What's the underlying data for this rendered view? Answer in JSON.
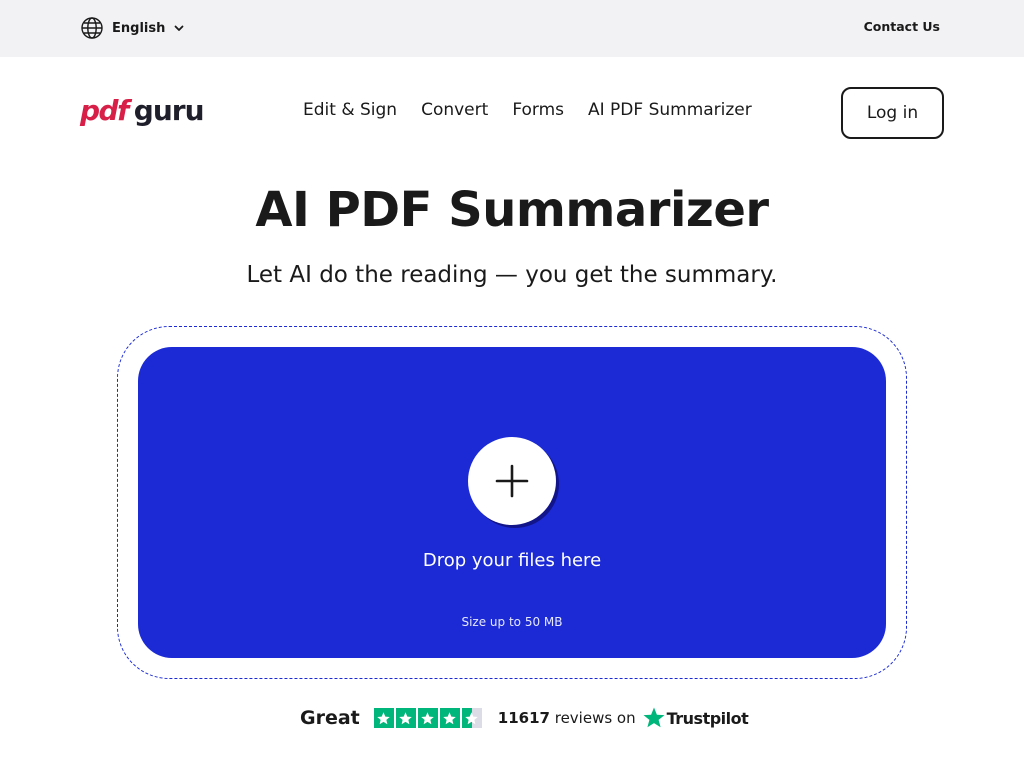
{
  "topbar": {
    "language_label": "English",
    "contact_label": "Contact Us"
  },
  "header": {
    "logo": {
      "part1": "pdf",
      "part2": "guru"
    },
    "nav": [
      {
        "label": "Edit & Sign"
      },
      {
        "label": "Convert"
      },
      {
        "label": "Forms"
      },
      {
        "label": "AI PDF Summarizer"
      }
    ],
    "login_label": "Log in"
  },
  "hero": {
    "title": "AI PDF Summarizer",
    "subtitle": "Let AI do the reading — you get the summary."
  },
  "dropzone": {
    "drop_label": "Drop your files here",
    "size_note": "Size up to 50 MB",
    "icon": "plus-icon"
  },
  "trustpilot": {
    "rating_word": "Great",
    "stars": 4.5,
    "review_count": "11617",
    "reviews_suffix": "reviews on",
    "brand": "Trustpilot"
  },
  "colors": {
    "accent": "#1b2ad4",
    "brand_red": "#d81f48",
    "trustpilot_green": "#00b67a",
    "topbar_bg": "#f2f2f4"
  }
}
